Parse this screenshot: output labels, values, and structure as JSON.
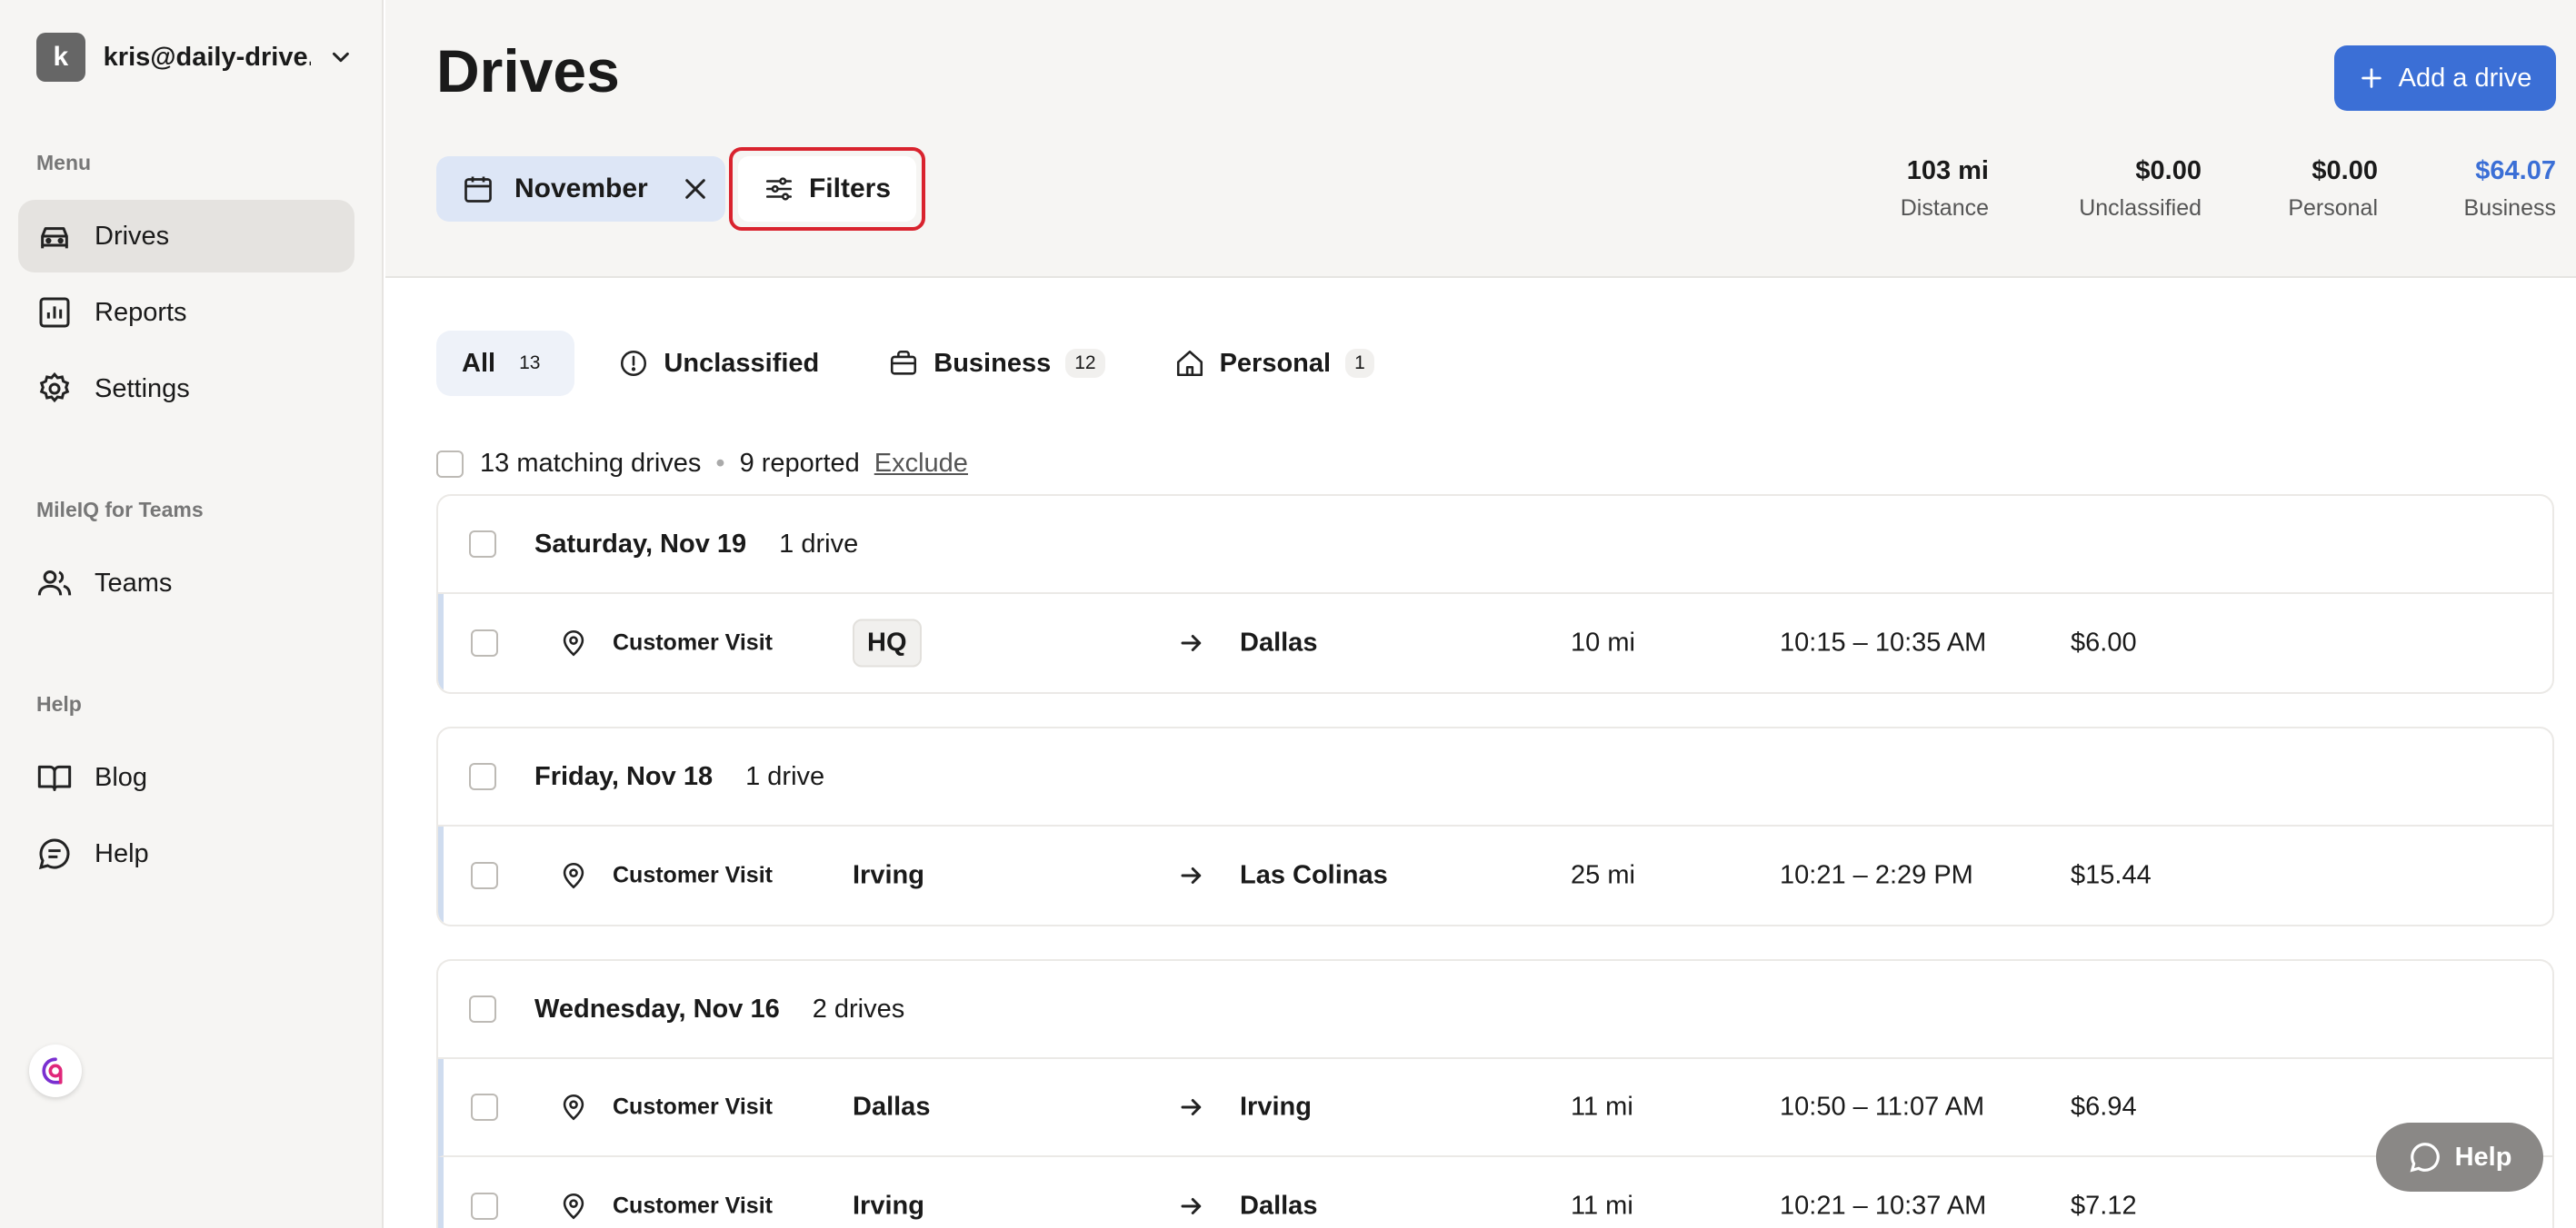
{
  "account": {
    "initial": "k",
    "email": "kris@daily-drive..."
  },
  "sidebar": {
    "menu_label": "Menu",
    "menu_items": [
      {
        "label": "Drives",
        "icon": "car-icon",
        "active": true
      },
      {
        "label": "Reports",
        "icon": "chart-icon"
      },
      {
        "label": "Settings",
        "icon": "gear-icon"
      }
    ],
    "teams_label": "MileIQ for Teams",
    "teams_items": [
      {
        "label": "Teams",
        "icon": "people-icon"
      }
    ],
    "help_label": "Help",
    "help_items": [
      {
        "label": "Blog",
        "icon": "book-icon"
      },
      {
        "label": "Help",
        "icon": "chat-icon"
      }
    ]
  },
  "header": {
    "title": "Drives",
    "month_filter": "November",
    "filters_label": "Filters",
    "add_drive_label": "Add a drive",
    "stats": [
      {
        "value": "103 mi",
        "label": "Distance"
      },
      {
        "value": "$0.00",
        "label": "Unclassified"
      },
      {
        "value": "$0.00",
        "label": "Personal"
      },
      {
        "value": "$64.07",
        "label": "Business"
      }
    ]
  },
  "tabs": [
    {
      "label": "All",
      "count": "13"
    },
    {
      "label": "Unclassified",
      "count": ""
    },
    {
      "label": "Business",
      "count": "12"
    },
    {
      "label": "Personal",
      "count": "1"
    }
  ],
  "summary": {
    "matching": "13 matching drives",
    "reported": "9 reported",
    "exclude": "Exclude"
  },
  "days": [
    {
      "date": "Saturday, Nov 19",
      "count": "1 drive",
      "drives": [
        {
          "purpose": "Customer Visit",
          "from": "HQ",
          "to": "Dallas",
          "distance": "10 mi",
          "time": "10:15 – 10:35 AM",
          "amount": "$6.00"
        }
      ]
    },
    {
      "date": "Friday, Nov 18",
      "count": "1 drive",
      "drives": [
        {
          "purpose": "Customer Visit",
          "from": "Irving",
          "to": "Las Colinas",
          "distance": "25 mi",
          "time": "10:21 – 2:29 PM",
          "amount": "$15.44"
        }
      ]
    },
    {
      "date": "Wednesday, Nov 16",
      "count": "2 drives",
      "drives": [
        {
          "purpose": "Customer Visit",
          "from": "Dallas",
          "to": "Irving",
          "distance": "11 mi",
          "time": "10:50 – 11:07 AM",
          "amount": "$6.94"
        },
        {
          "purpose": "Customer Visit",
          "from": "Irving",
          "to": "Dallas",
          "distance": "11 mi",
          "time": "10:21 – 10:37 AM",
          "amount": "$7.12"
        }
      ]
    }
  ],
  "help_button": "Help",
  "colors": {
    "accent": "#3b6fd6",
    "highlight_outline": "#d9232e"
  }
}
